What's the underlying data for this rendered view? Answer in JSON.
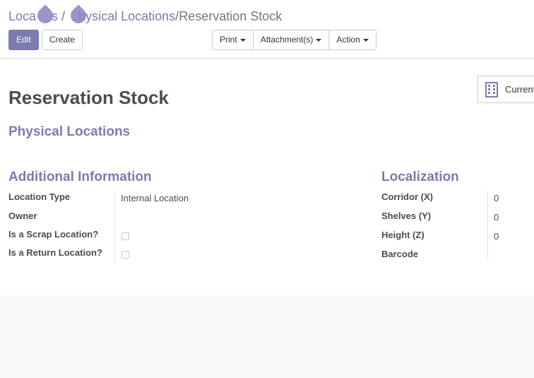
{
  "breadcrumb": {
    "items": [
      "Locations",
      "Physical Locations",
      "Reservation Stock"
    ],
    "separator": "/",
    "link1_visible": "Loca",
    "link1_tail": "s",
    "link2_tail": "hysical Locations"
  },
  "buttons": {
    "edit": "Edit",
    "create": "Create",
    "print": "Print",
    "attachments": "Attachment(s)",
    "action": "Action"
  },
  "stat_button": {
    "label": "Current",
    "icon": "building-icon"
  },
  "record": {
    "name": "Reservation Stock",
    "parent": "Physical Locations"
  },
  "additional_info": {
    "title": "Additional Information",
    "fields": {
      "location_type": {
        "label": "Location Type",
        "value": "Internal Location"
      },
      "owner": {
        "label": "Owner",
        "value": ""
      },
      "scrap": {
        "label": "Is a Scrap Location?",
        "checked": false
      },
      "return": {
        "label": "Is a Return Location?",
        "checked": false
      }
    }
  },
  "localization": {
    "title": "Localization",
    "fields": {
      "corridor": {
        "label": "Corridor (X)",
        "value": "0"
      },
      "shelves": {
        "label": "Shelves (Y)",
        "value": "0"
      },
      "height": {
        "label": "Height (Z)",
        "value": "0"
      },
      "barcode": {
        "label": "Barcode",
        "value": ""
      }
    }
  },
  "colors": {
    "primary": "#7c7bad",
    "overlay_drop": "#8684bf"
  }
}
